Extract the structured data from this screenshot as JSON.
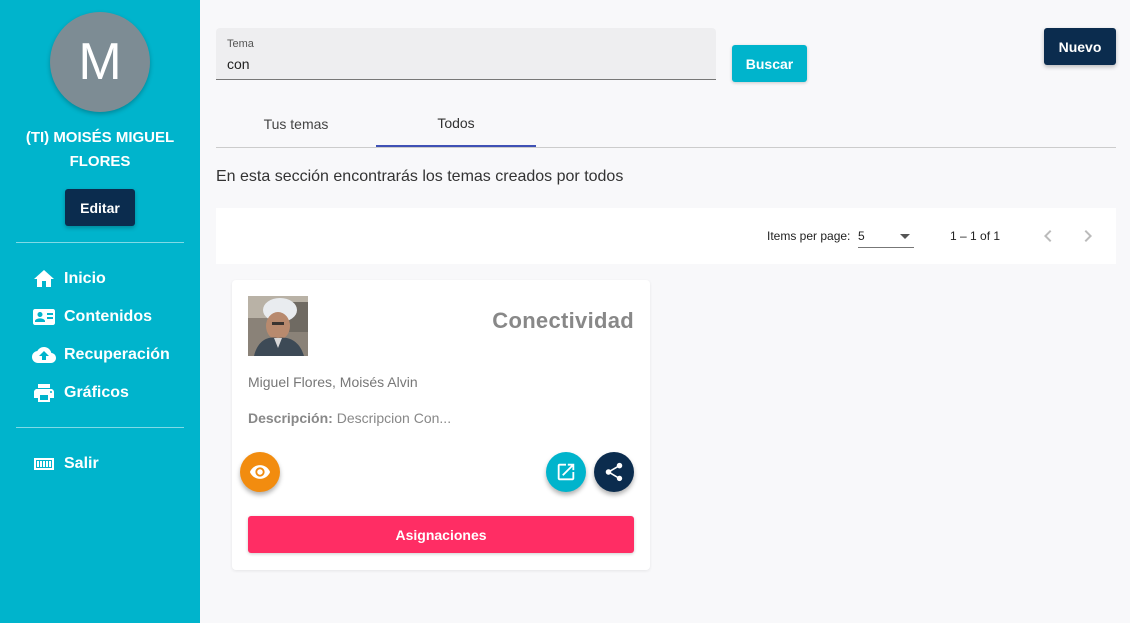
{
  "sidebar": {
    "avatar_letter": "M",
    "user_line1": "(TI) MOISÉS MIGUEL",
    "user_line2": "FLORES",
    "edit_label": "Editar",
    "items": [
      {
        "label": "Inicio",
        "icon": "home-icon"
      },
      {
        "label": "Contenidos",
        "icon": "contact-card-icon"
      },
      {
        "label": "Recuperación",
        "icon": "cloud-upload-icon"
      },
      {
        "label": "Gráficos",
        "icon": "printer-icon"
      }
    ],
    "logout": {
      "label": "Salir",
      "icon": "logout-icon"
    }
  },
  "search": {
    "label": "Tema",
    "value": "con",
    "button_label": "Buscar"
  },
  "new_label": "Nuevo",
  "tabs": [
    {
      "label": "Tus temas",
      "active": false
    },
    {
      "label": "Todos",
      "active": true
    }
  ],
  "section_description": "En esta sección encontrarás los temas creados por todos",
  "paginator": {
    "items_per_page_label": "Items per page:",
    "items_per_page_value": "5",
    "range_label": "1 – 1 of 1"
  },
  "cards": [
    {
      "title": "Conectividad",
      "author": "Miguel Flores, Moisés Alvin",
      "description_label": "Descripción:",
      "description_value": "Descripcion Con...",
      "assign_label": "Asignaciones"
    }
  ],
  "colors": {
    "sidebar": "#00b4cc",
    "navy": "#0b2c4e",
    "view_fab": "#f28c0f",
    "open_fab": "#00b4cc",
    "share_fab": "#0b2c4e",
    "assign": "#ff2d64",
    "tab_indicator": "#3f51b5"
  }
}
